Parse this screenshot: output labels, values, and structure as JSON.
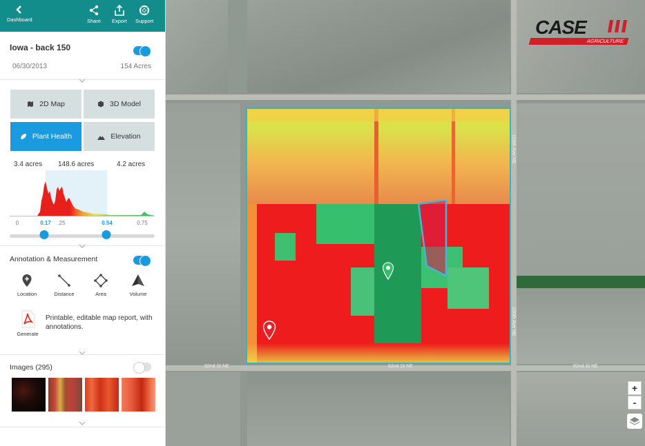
{
  "toolbar": {
    "dashboard_label": "Dashboard",
    "share_label": "Share",
    "export_label": "Export",
    "support_label": "Support"
  },
  "field": {
    "name": "Iowa - back 150",
    "date": "06/30/2013",
    "acres": "154 Acres",
    "visible_toggle_on": true
  },
  "map_modes": {
    "items": [
      {
        "label": "2D Map",
        "icon": "map-icon",
        "active": false
      },
      {
        "label": "3D Model",
        "icon": "cube-icon",
        "active": false
      },
      {
        "label": "Plant Health",
        "icon": "leaf-icon",
        "active": true
      },
      {
        "label": "Elevation",
        "icon": "mountain-icon",
        "active": false
      }
    ]
  },
  "plant_health": {
    "acres_low": "3.4 acres",
    "acres_mid": "148.6 acres",
    "acres_high": "4.2 acres",
    "ticks": [
      "0",
      "0.17",
      ".25",
      "0.54",
      "0.75"
    ],
    "range_low": 0.17,
    "range_high": 0.54
  },
  "annotation": {
    "title": "Annotation & Measurement",
    "toggle_on": true,
    "tools": [
      {
        "label": "Location",
        "icon": "location-pin-icon"
      },
      {
        "label": "Distance",
        "icon": "ruler-line-icon"
      },
      {
        "label": "Area",
        "icon": "area-polygon-icon"
      },
      {
        "label": "Volume",
        "icon": "volume-pyramid-icon"
      }
    ],
    "generate_label": "Generate",
    "generate_desc": "Printable, editable map report, with annotations."
  },
  "images": {
    "title": "Images (295)",
    "toggle_on": false
  },
  "map": {
    "roads": {
      "road_82nd_left": "82nd St NE",
      "road_82nd_mid": "82nd St NE",
      "road_82nd_right": "82nd St NE",
      "road_v_top": "150th Ave NE",
      "road_v_bottom": "150th Ave NE"
    },
    "logo_word": "CASE",
    "logo_sub": "AGRICULTURE",
    "zoom_in": "+",
    "zoom_out": "-"
  },
  "colors": {
    "teal": "#138c8c",
    "accent_blue": "#1a9be0",
    "health_red": "#ee1c1c",
    "health_green": "#2fbf6a",
    "logo_red": "#d11f2a"
  }
}
